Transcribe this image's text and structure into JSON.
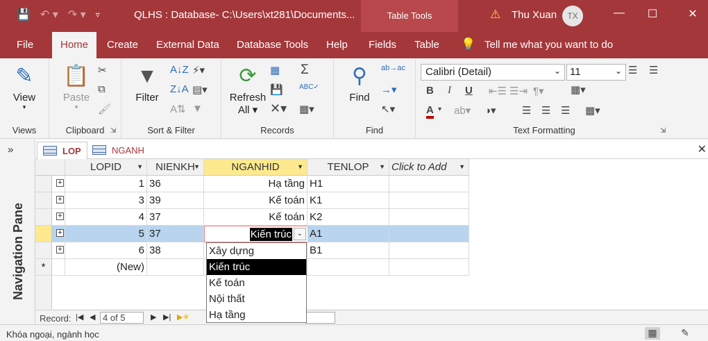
{
  "title_bar": {
    "window_title": "QLHS : Database- C:\\Users\\xt281\\Documents...",
    "context_tab": "Table Tools",
    "user_name": "Thu Xuan",
    "user_initials": "TX",
    "qat_icons": [
      "save-icon",
      "undo-icon",
      "redo-icon",
      "customize-icon"
    ],
    "window_buttons": [
      "minimize",
      "restore",
      "close"
    ]
  },
  "ribbon_tabs": [
    "File",
    "Home",
    "Create",
    "External Data",
    "Database Tools",
    "Help",
    "Fields",
    "Table"
  ],
  "active_tab": "Home",
  "tell_me": "Tell me what you want to do",
  "ribbon": {
    "views": {
      "label": "Views",
      "view_button": "View"
    },
    "clipboard": {
      "label": "Clipboard",
      "paste_button": "Paste"
    },
    "sort_filter": {
      "label": "Sort & Filter",
      "filter_button": "Filter"
    },
    "records": {
      "label": "Records",
      "refresh_button": "Refresh",
      "refresh_sub": "All"
    },
    "find": {
      "label": "Find",
      "find_button": "Find"
    },
    "text_formatting": {
      "label": "Text Formatting",
      "font_name": "Calibri (Detail)",
      "font_size": "11",
      "font_color": "#c00000"
    }
  },
  "nav_pane": {
    "label": "Navigation Pane"
  },
  "doc_tabs": [
    {
      "label": "LOP",
      "active": true
    },
    {
      "label": "NGANH",
      "active": false
    }
  ],
  "table": {
    "columns": [
      "LOPID",
      "NIENKH",
      "NGANHID",
      "TENLOP",
      "Click to Add"
    ],
    "selected_column": "NGANHID",
    "rows": [
      {
        "lopid": "1",
        "nienkh": "36",
        "nganhid": "Hạ tầng",
        "tenlop": "H1"
      },
      {
        "lopid": "3",
        "nienkh": "39",
        "nganhid": "Kế toán",
        "tenlop": "K1"
      },
      {
        "lopid": "4",
        "nienkh": "37",
        "nganhid": "Kế toán",
        "tenlop": "K2"
      },
      {
        "lopid": "5",
        "nienkh": "37",
        "nganhid": "Kiến trúc",
        "tenlop": "A1"
      },
      {
        "lopid": "6",
        "nienkh": "38",
        "nganhid": "",
        "tenlop": "B1"
      }
    ],
    "new_row_label": "(New)",
    "new_row_marker": "*",
    "current_row_index": 3
  },
  "dropdown": {
    "options": [
      "Xây dựng",
      "Kiến trúc",
      "Kế toán",
      "Nội thất",
      "Hạ tầng"
    ],
    "selected": "Kiến trúc"
  },
  "record_nav": {
    "label": "Record:",
    "position": "4 of 5"
  },
  "status_bar": {
    "text": "Khóa ngoại, ngành học"
  },
  "colors": {
    "accent": "#a4373a",
    "row_highlight": "#b8d4ee",
    "selected_header": "#fde98e"
  }
}
